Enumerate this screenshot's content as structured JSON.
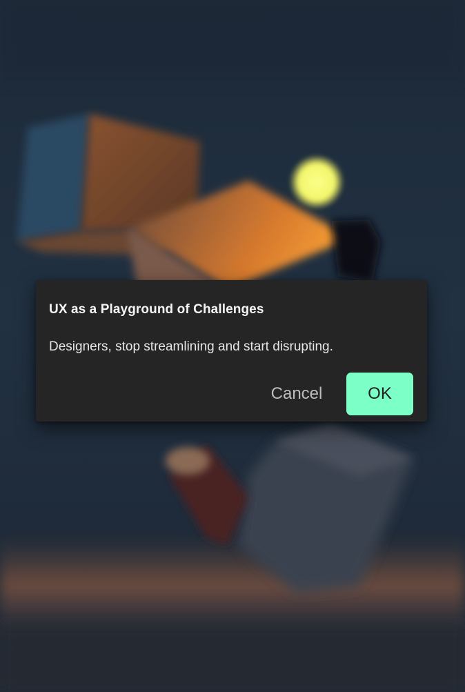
{
  "background": {
    "description_icon": "blurred-3d-cubes-scene-image"
  },
  "dialog": {
    "title": "UX as a Playground of Challenges",
    "message": "Designers, stop streamlining and start disrupting.",
    "cancel_label": "Cancel",
    "ok_label": "OK"
  },
  "colors": {
    "dialog_bg": "#252525",
    "ok_accent": "#7dffc8",
    "cancel_text": "#bdbdbd",
    "title_text": "#f4f4f4"
  }
}
